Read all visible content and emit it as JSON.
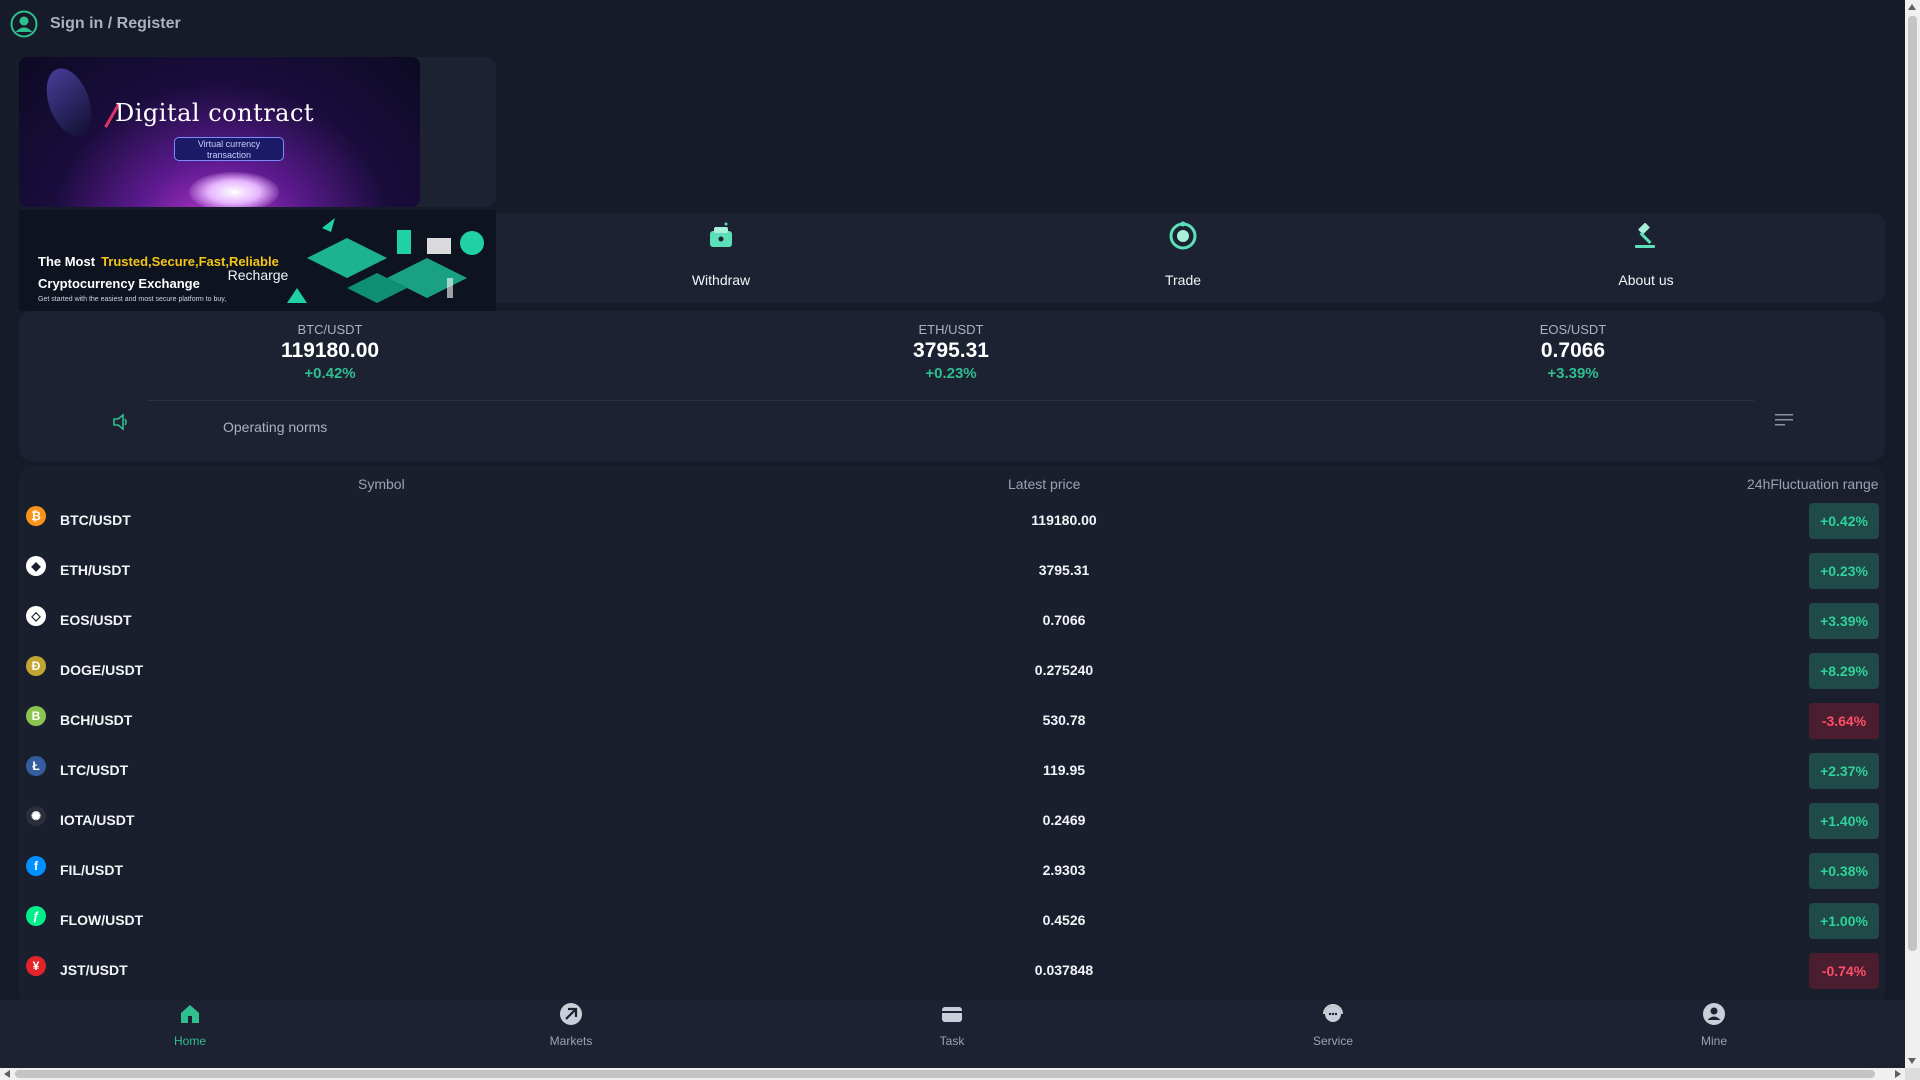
{
  "header": {
    "signin_label": "Sign in / Register",
    "avatar_icon": "user-avatar-icon"
  },
  "banner": {
    "title": "Digital contract",
    "subtitle": "Virtual currency transaction",
    "tagline_prefix": "The Most",
    "tagline_highlight": "Trusted,Secure,Fast,Reliable",
    "tagline_line2": "Cryptocurrency Exchange",
    "tagline_small": "Get started with the easiest and most secure platform to buy,"
  },
  "actions": [
    {
      "label": "Recharge",
      "icon": "recharge-icon"
    },
    {
      "label": "Withdraw",
      "icon": "wallet-icon"
    },
    {
      "label": "Trade",
      "icon": "trade-icon"
    },
    {
      "label": "About us",
      "icon": "gavel-icon"
    }
  ],
  "tickers": [
    {
      "pair": "BTC/USDT",
      "price": "119180.00",
      "change": "+0.42%"
    },
    {
      "pair": "ETH/USDT",
      "price": "3795.31",
      "change": "+0.23%"
    },
    {
      "pair": "EOS/USDT",
      "price": "0.7066",
      "change": "+3.39%"
    }
  ],
  "notice": {
    "text": "Operating norms",
    "icon": "speaker-icon",
    "menu_icon": "menu-lines-icon"
  },
  "table": {
    "headers": {
      "symbol": "Symbol",
      "price": "Latest price",
      "range": "24hFluctuation range"
    },
    "rows": [
      {
        "symbol": "BTC/USDT",
        "price": "119180.00",
        "change": "+0.42%",
        "positive": true,
        "coin_color": "#f7931a",
        "coin_glyph": "₿"
      },
      {
        "symbol": "ETH/USDT",
        "price": "3795.31",
        "change": "+0.23%",
        "positive": true,
        "coin_color": "#ffffff",
        "coin_glyph": "◆"
      },
      {
        "symbol": "EOS/USDT",
        "price": "0.7066",
        "change": "+3.39%",
        "positive": true,
        "coin_color": "#ffffff",
        "coin_glyph": "◇"
      },
      {
        "symbol": "DOGE/USDT",
        "price": "0.275240",
        "change": "+8.29%",
        "positive": true,
        "coin_color": "#c2a633",
        "coin_glyph": "Ð"
      },
      {
        "symbol": "BCH/USDT",
        "price": "530.78",
        "change": "-3.64%",
        "positive": false,
        "coin_color": "#8dc351",
        "coin_glyph": "B"
      },
      {
        "symbol": "LTC/USDT",
        "price": "119.95",
        "change": "+2.37%",
        "positive": true,
        "coin_color": "#345d9d",
        "coin_glyph": "Ł"
      },
      {
        "symbol": "IOTA/USDT",
        "price": "0.2469",
        "change": "+1.40%",
        "positive": true,
        "coin_color": "#2b2f3a",
        "coin_glyph": "✺"
      },
      {
        "symbol": "FIL/USDT",
        "price": "2.9303",
        "change": "+0.38%",
        "positive": true,
        "coin_color": "#0090ff",
        "coin_glyph": "f"
      },
      {
        "symbol": "FLOW/USDT",
        "price": "0.4526",
        "change": "+1.00%",
        "positive": true,
        "coin_color": "#00ef8b",
        "coin_glyph": "ƒ"
      },
      {
        "symbol": "JST/USDT",
        "price": "0.037848",
        "change": "-0.74%",
        "positive": false,
        "coin_color": "#e3242b",
        "coin_glyph": "¥"
      }
    ]
  },
  "bottom_nav": [
    {
      "label": "Home",
      "icon": "home-icon",
      "active": true
    },
    {
      "label": "Markets",
      "icon": "markets-icon",
      "active": false
    },
    {
      "label": "Task",
      "icon": "task-icon",
      "active": false
    },
    {
      "label": "Service",
      "icon": "service-icon",
      "active": false
    },
    {
      "label": "Mine",
      "icon": "mine-icon",
      "active": false
    }
  ],
  "colors": {
    "accent": "#2fbf8f",
    "positive": "#2fd29b",
    "negative": "#ff4d6a",
    "background": "#161b29",
    "panel": "#1c2232"
  }
}
